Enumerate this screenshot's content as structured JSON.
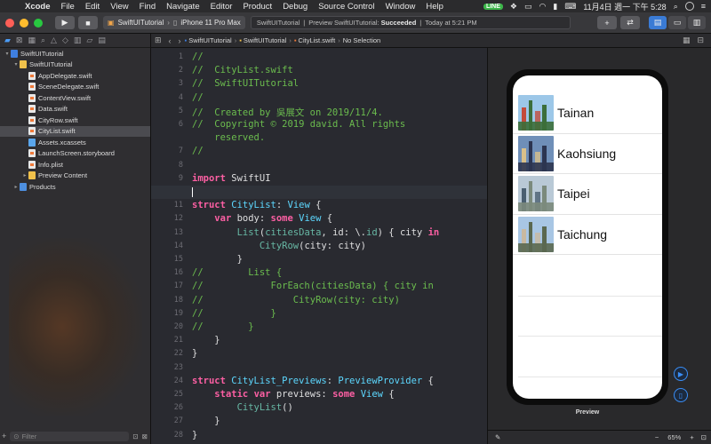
{
  "menubar": {
    "app_name": "Xcode",
    "menus": [
      "File",
      "Edit",
      "View",
      "Find",
      "Navigate",
      "Editor",
      "Product",
      "Debug",
      "Source Control",
      "Window",
      "Help"
    ],
    "status_badge": "LINE",
    "clock": "11月4日 週一 下午 5:28"
  },
  "toolbar": {
    "scheme": "SwiftUITutorial",
    "device": "iPhone 11 Pro Max",
    "status_project": "SwiftUITutorial",
    "status_action": "Preview SwiftUITutorial:",
    "status_result": "Succeeded",
    "status_time": "Today at 5:21 PM",
    "add_label": "+"
  },
  "navigator": {
    "filter_placeholder": "Filter",
    "items": [
      {
        "label": "SwiftUITutorial",
        "indent": 0,
        "kind": "proj",
        "disc": "▾"
      },
      {
        "label": "SwiftUITutorial",
        "indent": 1,
        "kind": "folder",
        "disc": "▾"
      },
      {
        "label": "AppDelegate.swift",
        "indent": 2,
        "kind": "file",
        "disc": ""
      },
      {
        "label": "SceneDelegate.swift",
        "indent": 2,
        "kind": "file",
        "disc": ""
      },
      {
        "label": "ContentView.swift",
        "indent": 2,
        "kind": "file",
        "disc": ""
      },
      {
        "label": "Data.swift",
        "indent": 2,
        "kind": "file",
        "disc": ""
      },
      {
        "label": "CityRow.swift",
        "indent": 2,
        "kind": "file",
        "disc": ""
      },
      {
        "label": "CityList.swift",
        "indent": 2,
        "kind": "file",
        "disc": "",
        "selected": true
      },
      {
        "label": "Assets.xcassets",
        "indent": 2,
        "kind": "asset",
        "disc": ""
      },
      {
        "label": "LaunchScreen.storyboard",
        "indent": 2,
        "kind": "file",
        "disc": ""
      },
      {
        "label": "Info.plist",
        "indent": 2,
        "kind": "file",
        "disc": ""
      },
      {
        "label": "Preview Content",
        "indent": 2,
        "kind": "folder",
        "disc": "▸"
      },
      {
        "label": "Products",
        "indent": 1,
        "kind": "folder blue",
        "disc": "▸"
      }
    ]
  },
  "jumpbar": {
    "crumbs": [
      "SwiftUITutorial",
      "SwiftUITutorial",
      "CityList.swift",
      "No Selection"
    ]
  },
  "editor": {
    "lines": [
      {
        "n": "1",
        "parts": [
          [
            "c",
            "//"
          ]
        ]
      },
      {
        "n": "2",
        "parts": [
          [
            "c",
            "//  CityList.swift"
          ]
        ]
      },
      {
        "n": "3",
        "parts": [
          [
            "c",
            "//  SwiftUITutorial"
          ]
        ]
      },
      {
        "n": "4",
        "parts": [
          [
            "c",
            "//"
          ]
        ]
      },
      {
        "n": "5",
        "parts": [
          [
            "c",
            "//  Created by 吳展文 on 2019/11/4."
          ]
        ]
      },
      {
        "n": "6",
        "parts": [
          [
            "c",
            "//  Copyright © 2019 david. All rights"
          ]
        ]
      },
      {
        "n": "",
        "parts": [
          [
            "c",
            "    reserved."
          ]
        ]
      },
      {
        "n": "7",
        "parts": [
          [
            "c",
            "//"
          ]
        ]
      },
      {
        "n": "8",
        "parts": []
      },
      {
        "n": "9",
        "parts": [
          [
            "k",
            "import"
          ],
          [
            "tx",
            " SwiftUI"
          ]
        ]
      },
      {
        "n": "10",
        "parts": [],
        "current": true
      },
      {
        "n": "11",
        "parts": [
          [
            "k",
            "struct"
          ],
          [
            "tx",
            " "
          ],
          [
            "t",
            "CityList"
          ],
          [
            "tx",
            ": "
          ],
          [
            "t",
            "View"
          ],
          [
            "tx",
            " {"
          ]
        ]
      },
      {
        "n": "12",
        "parts": [
          [
            "tx",
            "    "
          ],
          [
            "k",
            "var"
          ],
          [
            "tx",
            " body: "
          ],
          [
            "k",
            "some"
          ],
          [
            "tx",
            " "
          ],
          [
            "t",
            "View"
          ],
          [
            "tx",
            " {"
          ]
        ]
      },
      {
        "n": "13",
        "parts": [
          [
            "tx",
            "        "
          ],
          [
            "f",
            "List"
          ],
          [
            "tx",
            "("
          ],
          [
            "f",
            "citiesData"
          ],
          [
            "tx",
            ", id: \\."
          ],
          [
            "f",
            "id"
          ],
          [
            "tx",
            ") { city "
          ],
          [
            "k",
            "in"
          ]
        ]
      },
      {
        "n": "14",
        "parts": [
          [
            "tx",
            "            "
          ],
          [
            "f",
            "CityRow"
          ],
          [
            "tx",
            "(city: city)"
          ]
        ]
      },
      {
        "n": "15",
        "parts": [
          [
            "tx",
            "        }"
          ]
        ]
      },
      {
        "n": "16",
        "parts": [
          [
            "c",
            "//        List {"
          ]
        ]
      },
      {
        "n": "17",
        "parts": [
          [
            "c",
            "//            ForEach(citiesData) { city in"
          ]
        ]
      },
      {
        "n": "18",
        "parts": [
          [
            "c",
            "//                CityRow(city: city)"
          ]
        ]
      },
      {
        "n": "19",
        "parts": [
          [
            "c",
            "//            }"
          ]
        ]
      },
      {
        "n": "20",
        "parts": [
          [
            "c",
            "//        }"
          ]
        ]
      },
      {
        "n": "21",
        "parts": [
          [
            "tx",
            "    }"
          ]
        ]
      },
      {
        "n": "22",
        "parts": [
          [
            "tx",
            "}"
          ]
        ]
      },
      {
        "n": "23",
        "parts": []
      },
      {
        "n": "24",
        "parts": [
          [
            "k",
            "struct"
          ],
          [
            "tx",
            " "
          ],
          [
            "t",
            "CityList_Previews"
          ],
          [
            "tx",
            ": "
          ],
          [
            "t",
            "PreviewProvider"
          ],
          [
            "tx",
            " {"
          ]
        ]
      },
      {
        "n": "25",
        "parts": [
          [
            "tx",
            "    "
          ],
          [
            "k",
            "static"
          ],
          [
            "tx",
            " "
          ],
          [
            "k",
            "var"
          ],
          [
            "tx",
            " previews: "
          ],
          [
            "k",
            "some"
          ],
          [
            "tx",
            " "
          ],
          [
            "t",
            "View"
          ],
          [
            "tx",
            " {"
          ]
        ]
      },
      {
        "n": "26",
        "parts": [
          [
            "tx",
            "        "
          ],
          [
            "f",
            "CityList"
          ],
          [
            "tx",
            "()"
          ]
        ]
      },
      {
        "n": "27",
        "parts": [
          [
            "tx",
            "    }"
          ]
        ]
      },
      {
        "n": "28",
        "parts": [
          [
            "tx",
            "}"
          ]
        ]
      }
    ]
  },
  "preview": {
    "label": "Preview",
    "zoom": "65%",
    "cities": [
      {
        "name": "Tainan",
        "sky": "#9cc7e8",
        "ground": "#3c6e3a",
        "accent": "#c34b3b"
      },
      {
        "name": "Kaohsiung",
        "sky": "#6f8fb8",
        "ground": "#2c3550",
        "accent": "#d9c08a"
      },
      {
        "name": "Taipei",
        "sky": "#b9c9d6",
        "ground": "#7b8a7c",
        "accent": "#4a5f70"
      },
      {
        "name": "Taichung",
        "sky": "#a8c6e4",
        "ground": "#5a6850",
        "accent": "#c9b9a0"
      }
    ]
  }
}
